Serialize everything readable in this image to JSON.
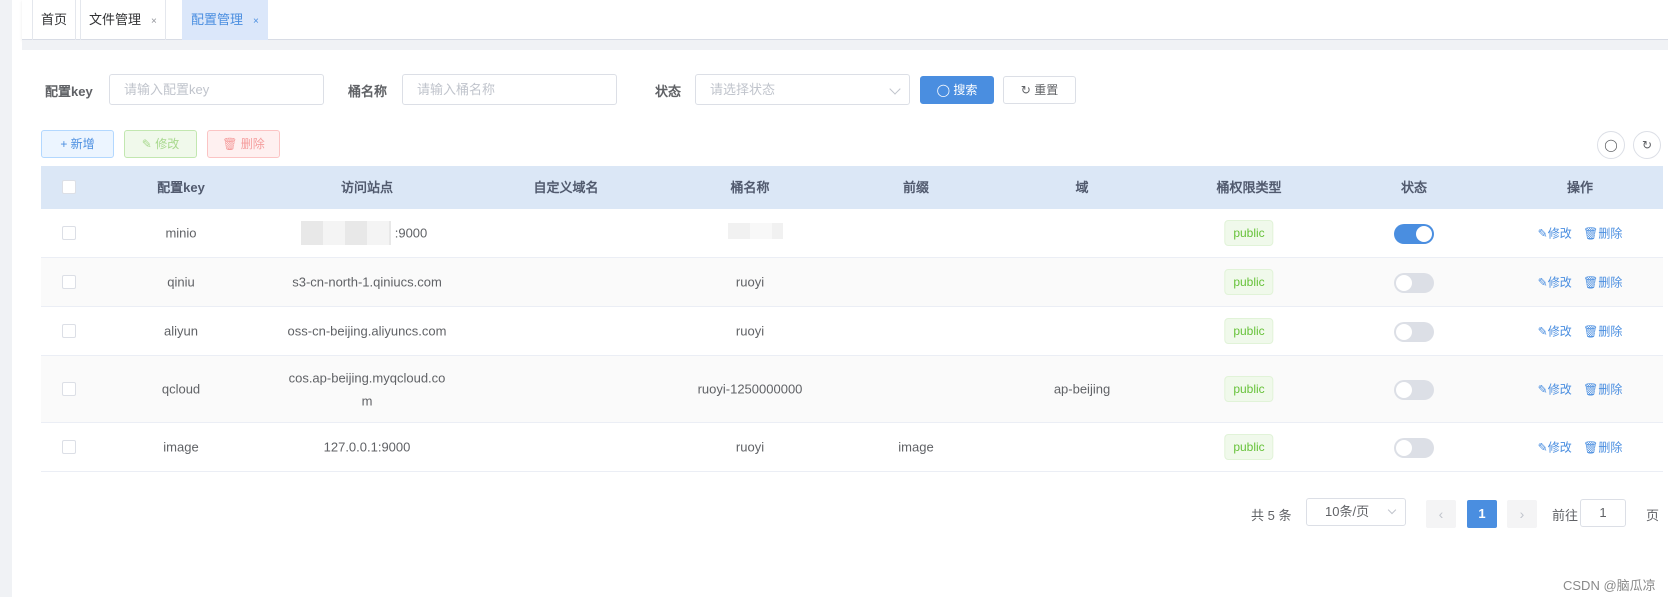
{
  "tabs": [
    {
      "label": "首页",
      "closable": false,
      "active": false
    },
    {
      "label": "文件管理",
      "closable": true,
      "active": false
    },
    {
      "label": "配置管理",
      "closable": true,
      "active": true
    }
  ],
  "tab_close_glyph": "×",
  "search": {
    "config_key_label": "配置key",
    "config_key_placeholder": "请输入配置key",
    "bucket_label": "桶名称",
    "bucket_placeholder": "请输入桶名称",
    "status_label": "状态",
    "status_placeholder": "请选择状态",
    "search_button": "搜索",
    "reset_button": "重置"
  },
  "toolbar": {
    "add_button": "新增",
    "edit_button": "修改",
    "delete_button": "删除",
    "right_icons": [
      "search-icon",
      "refresh-icon"
    ]
  },
  "table": {
    "headers": [
      "配置key",
      "访问站点",
      "自定义域名",
      "桶名称",
      "前缀",
      "域",
      "桶权限类型",
      "状态",
      "操作"
    ],
    "rows": [
      {
        "key": "minio",
        "endpoint": ":9000",
        "domain": "",
        "bucket": "",
        "prefix": "",
        "region": "",
        "access": "public",
        "status_on": true
      },
      {
        "key": "qiniu",
        "endpoint": "s3-cn-north-1.qiniucs.com",
        "domain": "",
        "bucket": "ruoyi",
        "prefix": "",
        "region": "",
        "access": "public",
        "status_on": false
      },
      {
        "key": "aliyun",
        "endpoint": "oss-cn-beijing.aliyuncs.com",
        "domain": "",
        "bucket": "ruoyi",
        "prefix": "",
        "region": "",
        "access": "public",
        "status_on": false
      },
      {
        "key": "qcloud",
        "endpoint_line1": "cos.ap-beijing.myqcloud.co",
        "endpoint_line2": "m",
        "domain": "",
        "bucket": "ruoyi-1250000000",
        "prefix": "",
        "region": "ap-beijing",
        "access": "public",
        "status_on": false
      },
      {
        "key": "image",
        "endpoint": "127.0.0.1:9000",
        "domain": "",
        "bucket": "ruoyi",
        "prefix": "image",
        "region": "",
        "access": "public",
        "status_on": false
      }
    ],
    "row_edit": "修改",
    "row_delete": "删除"
  },
  "pagination": {
    "total": "共 5 条",
    "page_size": "10条/页",
    "current_page": "1",
    "goto_label": "前往",
    "goto_value": "1",
    "page_suffix": "页"
  },
  "watermark": "CSDN @脑瓜凉",
  "colors": {
    "primary": "#4a8ee0",
    "success": "#67c23a",
    "danger": "#f56c6c"
  }
}
